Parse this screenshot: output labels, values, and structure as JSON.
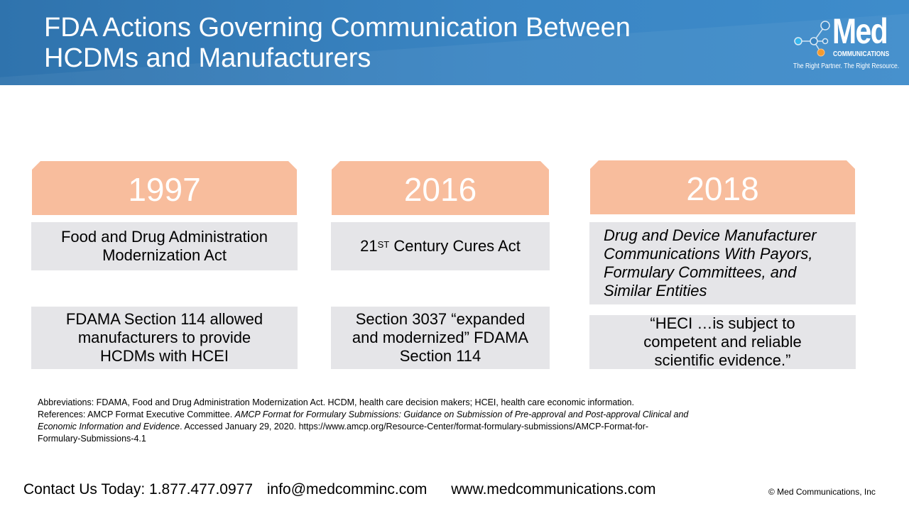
{
  "header": {
    "title_line1": "FDA Actions Governing Communication Between",
    "title_line2": "HCDMs and Manufacturers",
    "logo": {
      "word": "Med",
      "sub": "COMMUNICATIONS",
      "tagline": "The Right Partner. The Right Resource."
    }
  },
  "timeline": [
    {
      "year": "1997",
      "act": "Food and Drug Administration Modernization Act",
      "detail": "FDAMA Section 114 allowed manufacturers to provide HCDMs with HCEI"
    },
    {
      "year": "2016",
      "act_prefix": "21",
      "act_sup": "ST",
      "act_suffix": " Century Cures Act",
      "detail": "Section 3037 “expanded and modernized” FDAMA Section 114"
    },
    {
      "year": "2018",
      "act": "Drug and Device Manufacturer Communications With Payors, Formulary Committees, and Similar Entities",
      "detail": "“HECI …is subject to competent and reliable scientific evidence.”"
    }
  ],
  "notes": {
    "abbreviations": "Abbreviations: FDAMA, Food and Drug Administration Modernization Act. HCDM, health care decision makers; HCEI, health care economic information.",
    "references_prefix": "References: AMCP Format Executive Committee. ",
    "references_title": "AMCP Format for Formulary Submissions: Guidance on Submission of Pre-approval and Post-approval Clinical and Economic Information and Evidence",
    "references_suffix": ". Accessed January 29, 2020. https://www.amcp.org/Resource-Center/format-formulary-submissions/AMCP-Format-for-Formulary-Submissions-4.1"
  },
  "footer": {
    "phone": "Contact Us Today: 1.877.477.0977",
    "email": "info@medcomminc.com",
    "website": "www.medcommunications.com",
    "copyright": "© Med Communications, Inc"
  },
  "colors": {
    "header_blue": "#3a85c3",
    "year_peach": "#f8bd9d",
    "box_gray": "#e5e5e8"
  }
}
